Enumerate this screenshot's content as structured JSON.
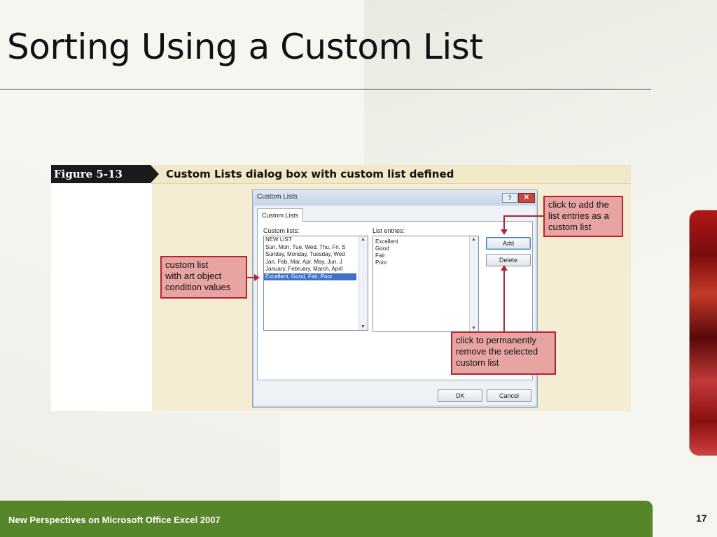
{
  "slide": {
    "title": "Sorting Using a Custom List",
    "footer": "New Perspectives on Microsoft Office Excel 2007",
    "page_number": "17"
  },
  "figure": {
    "label": "Figure  5-13",
    "caption": "Custom Lists dialog box with custom list defined"
  },
  "dialog": {
    "title": "Custom Lists",
    "help_glyph": "?",
    "close_glyph": "✕",
    "tab_label": "Custom Lists",
    "lists_label": "Custom lists:",
    "entries_label": "List entries:",
    "custom_lists": [
      "NEW LIST",
      "Sun, Mon, Tue, Wed, Thu, Fri, S",
      "Sunday, Monday, Tuesday, Wed",
      "Jan, Feb, Mar, Apr, May, Jun, J",
      "January, February, March, April",
      "Excellent, Good, Fair, Poor"
    ],
    "selected_index": 5,
    "list_entries": [
      "Excellent",
      "Good",
      "Fair",
      "Poor"
    ],
    "add_button": "Add",
    "delete_button": "Delete",
    "ok_button": "OK",
    "cancel_button": "Cancel"
  },
  "callouts": {
    "custom_list": [
      "custom list",
      "with art object",
      "condition values"
    ],
    "add": [
      "click to add the",
      "list entries as a",
      "custom list"
    ],
    "delete": [
      "click to permanently",
      "remove the selected",
      "custom list"
    ]
  },
  "colors": {
    "footer_bar": "#568629",
    "callout_fill": "#e8a3a3",
    "callout_border": "#b22434",
    "selection": "#3f6fc6"
  }
}
